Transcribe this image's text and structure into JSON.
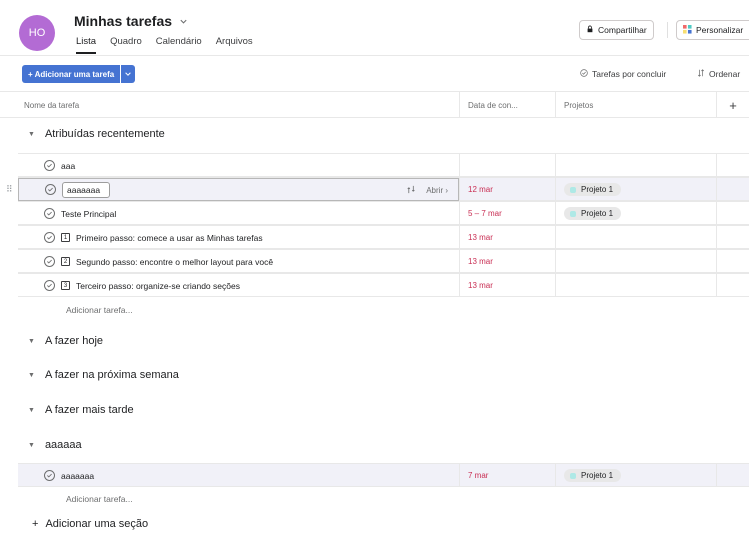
{
  "header": {
    "avatar_initials": "HO",
    "title": "Minhas tarefas",
    "tabs": [
      {
        "label": "Lista",
        "active": true
      },
      {
        "label": "Quadro",
        "active": false
      },
      {
        "label": "Calendário",
        "active": false
      },
      {
        "label": "Arquivos",
        "active": false
      }
    ],
    "share_label": "Compartilhar",
    "personalize_label": "Personalizar"
  },
  "toolbar": {
    "add_task_label": "+ Adicionar uma tarefa",
    "incomplete_label": "Tarefas por concluir",
    "sort_label": "Ordenar"
  },
  "columns": {
    "name": "Nome da tarefa",
    "date": "Data de con...",
    "projects": "Projetos",
    "add": "+"
  },
  "sections": [
    {
      "title": "Atribuídas recentemente",
      "tasks": [
        {
          "name": "aaa",
          "date": "",
          "project": ""
        },
        {
          "name": "aaaaaaa",
          "date": "12 mar",
          "project": "Projeto 1",
          "open_label": "Abrir"
        },
        {
          "name": "Teste Principal",
          "date": "5 – 7 mar",
          "project": "Projeto 1"
        },
        {
          "name": "Primeiro passo: comece a usar as Minhas tarefas",
          "icon_num": "1",
          "date": "13 mar",
          "project": ""
        },
        {
          "name": "Segundo passo: encontre o melhor layout para você",
          "icon_num": "2",
          "date": "13 mar",
          "project": ""
        },
        {
          "name": "Terceiro passo: organize-se criando seções",
          "icon_num": "3",
          "date": "13 mar",
          "project": ""
        }
      ],
      "add_task": "Adicionar tarefa..."
    },
    {
      "title": "A fazer hoje"
    },
    {
      "title": "A fazer na próxima semana"
    },
    {
      "title": "A fazer mais tarde"
    },
    {
      "title": "aaaaaa",
      "tasks": [
        {
          "name": "aaaaaaa",
          "date": "7 mar",
          "project": "Projeto 1"
        }
      ],
      "add_task": "Adicionar tarefa..."
    }
  ],
  "add_section_label": "Adicionar uma seção",
  "colors": {
    "accent": "#4573d2",
    "avatar": "#b36bd4",
    "due_date": "#c92f54",
    "project_dot": "#aee9e6"
  }
}
